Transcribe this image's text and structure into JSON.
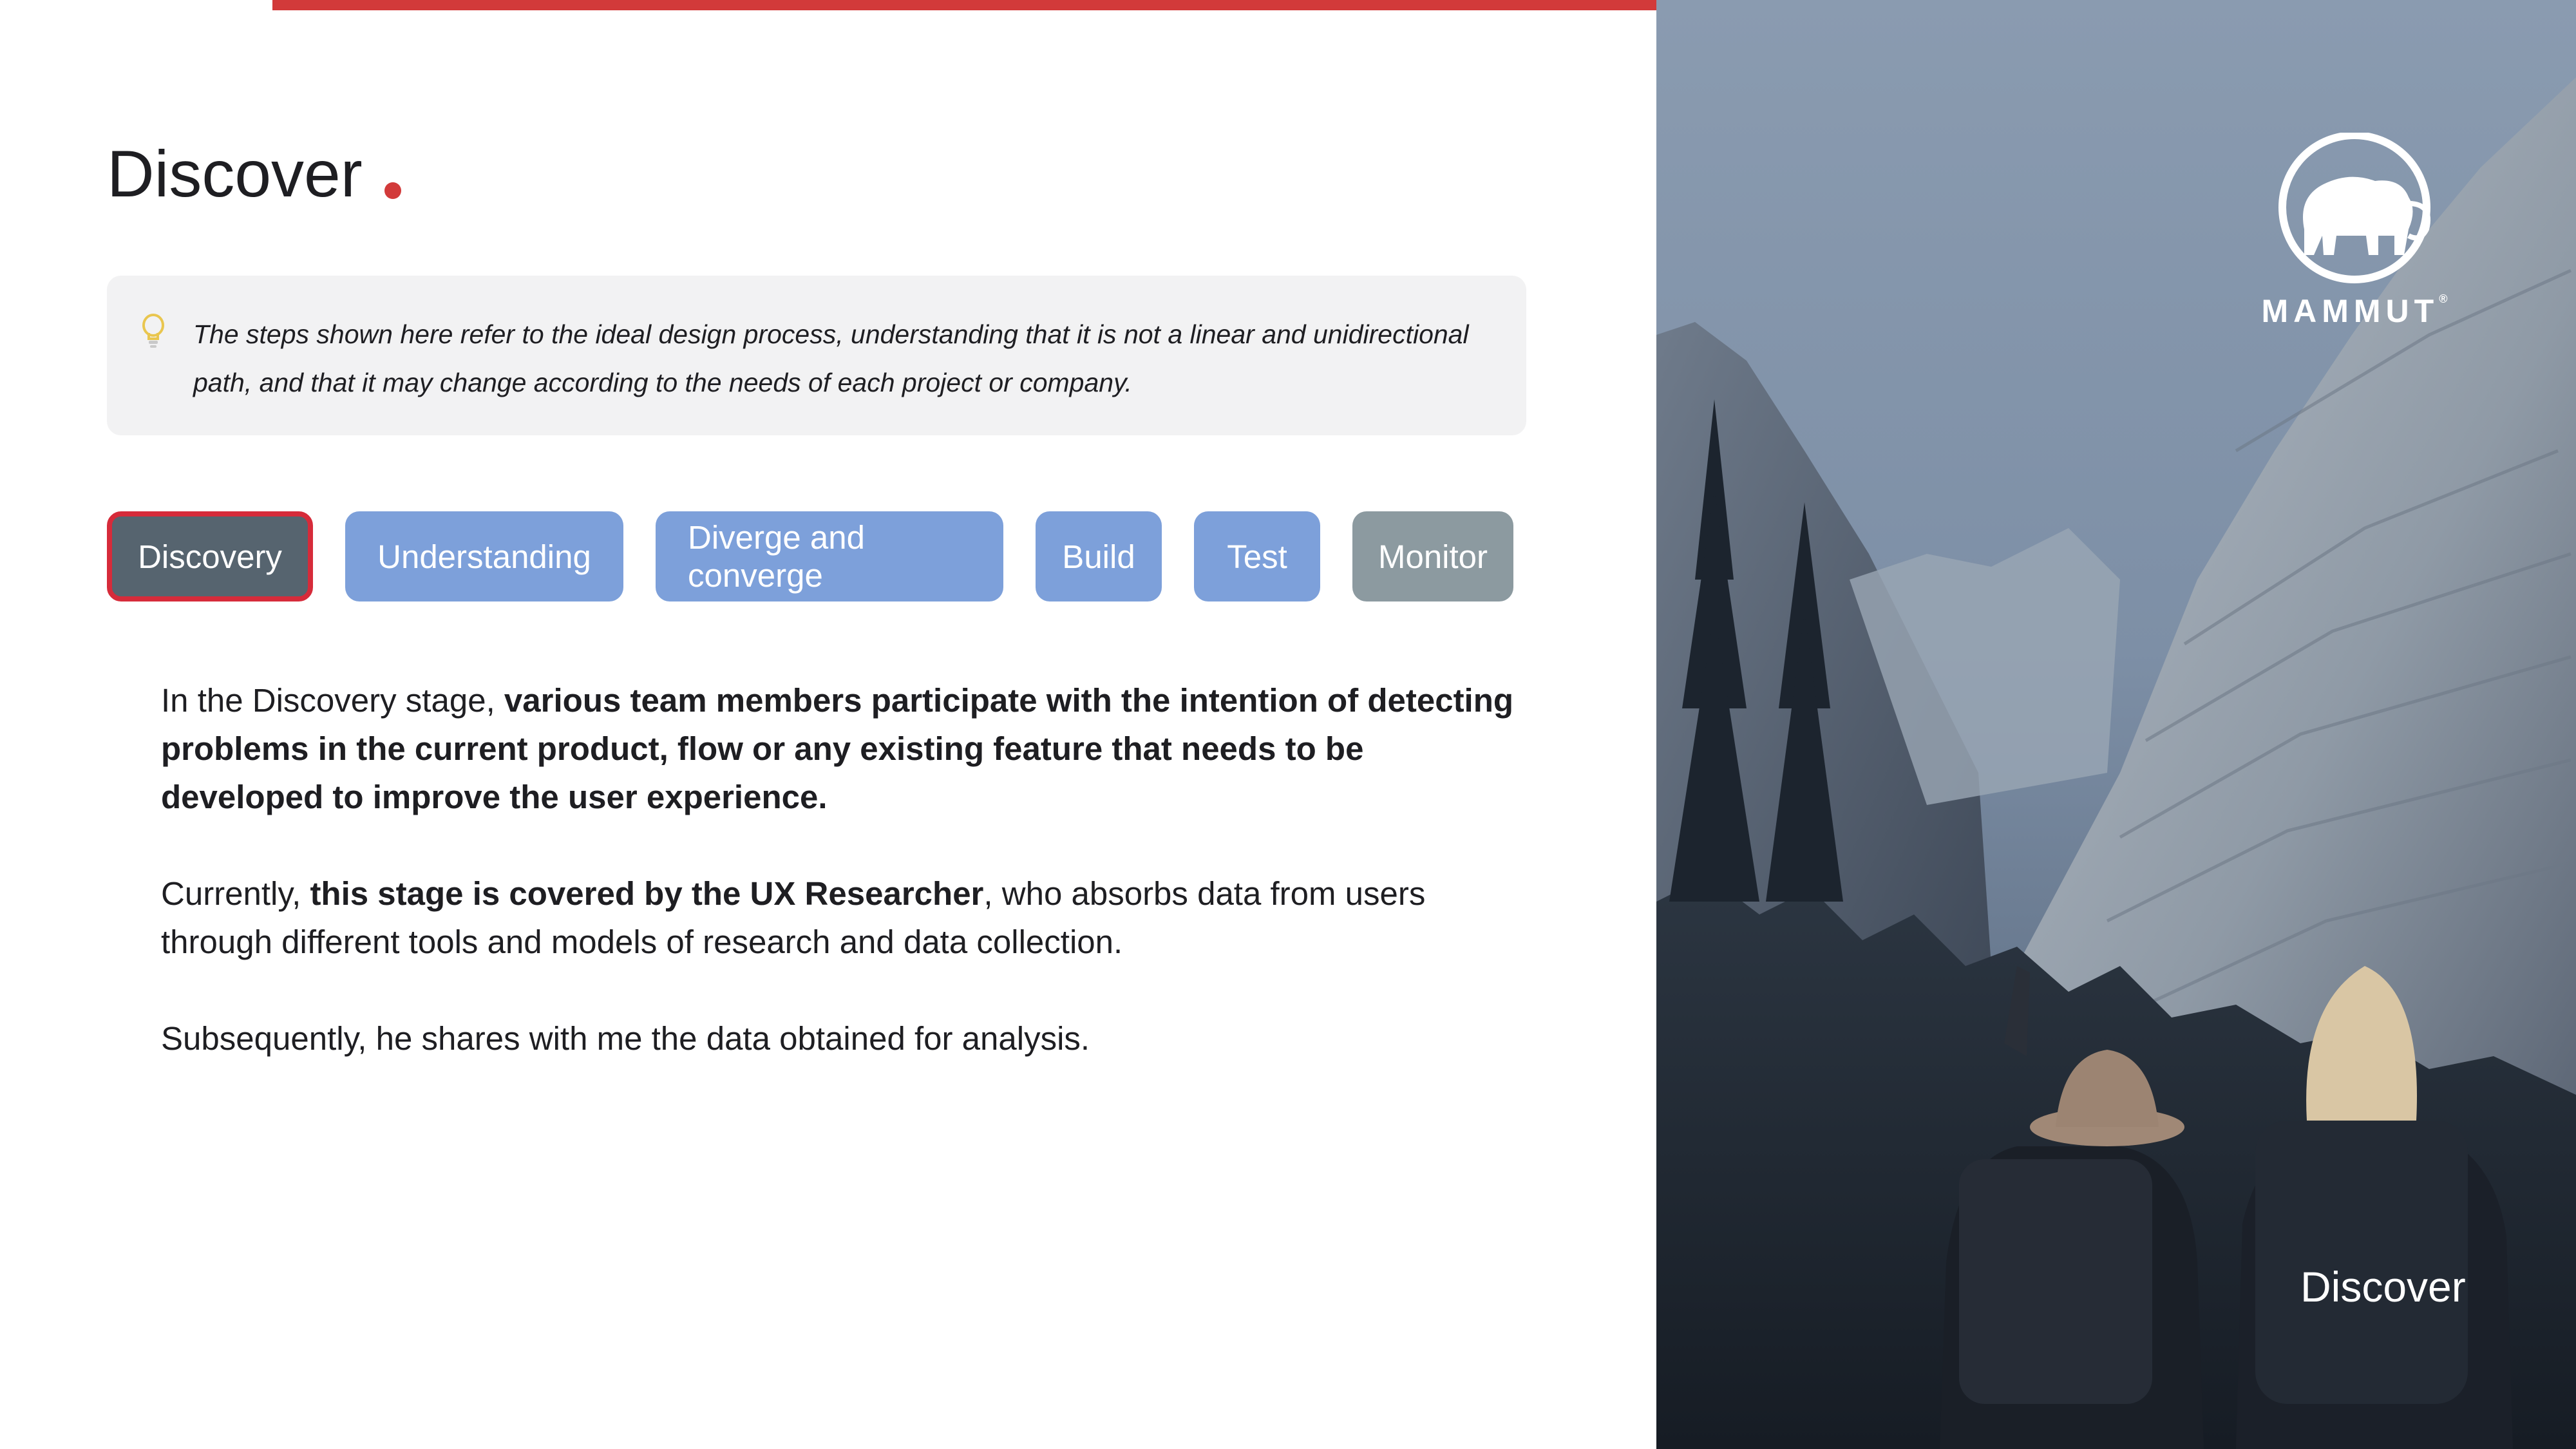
{
  "page": {
    "title": "Discover"
  },
  "note": {
    "icon": "lightbulb-icon",
    "text": "The steps shown here refer to the ideal design process, understanding that it is not a linear and unidirectional path, and that it may change according to the needs of each project or company."
  },
  "tabs": [
    {
      "label": "Discovery",
      "state": "active"
    },
    {
      "label": "Understanding",
      "state": "default"
    },
    {
      "label": "Diverge and converge",
      "state": "default"
    },
    {
      "label": "Build",
      "state": "default"
    },
    {
      "label": "Test",
      "state": "default"
    },
    {
      "label": "Monitor",
      "state": "muted"
    }
  ],
  "content": {
    "p1_plain": "In the Discovery stage, ",
    "p1_bold": "various team members participate with the intention of detecting problems in the current product, flow or any existing feature that needs to be developed to improve the user experience.",
    "p2_plain_a": "Currently, ",
    "p2_bold": "this stage is covered by the UX Researcher",
    "p2_plain_b": ", who absorbs data from users through different tools and models of research and data collection.",
    "p3": "Subsequently, he shares with me the data obtained for analysis."
  },
  "hero": {
    "brand": "MAMMUT",
    "brand_mark": "®",
    "logo_icon": "mammoth-logo-icon",
    "caption": "Discover"
  },
  "colors": {
    "accent_red": "#d23a3a",
    "tab_blue": "#7da0da",
    "tab_active": "#56646f",
    "tab_muted": "#8c9aa0",
    "note_bg": "#f2f2f3"
  }
}
